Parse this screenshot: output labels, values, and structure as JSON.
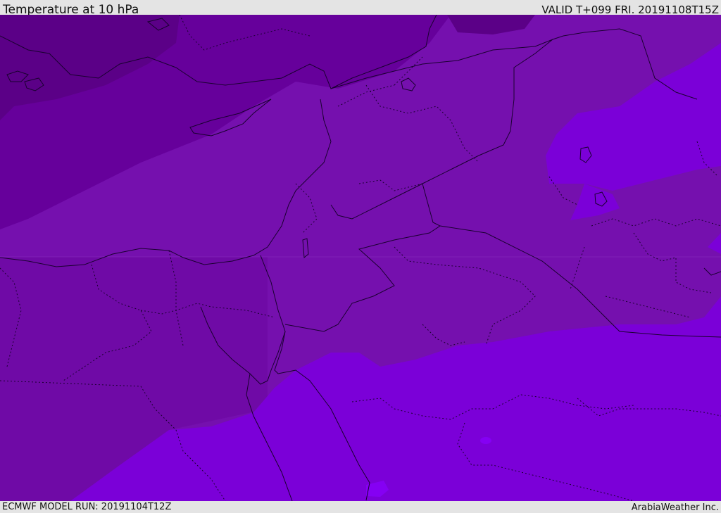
{
  "header": {
    "title": "Temperature at 10 hPa",
    "valid": "VALID T+099 FRI. 20191108T15Z"
  },
  "footer": {
    "model_run": "ECMWF MODEL RUN: 20191104T12Z",
    "credit": "ArabiaWeather Inc."
  },
  "colors": {
    "band_darkest": "#5b0087",
    "band_dark": "#66009b",
    "band_mid": "#7510ae",
    "band_light": "#7b00d8",
    "band_lightest": "#8500f3",
    "border_line": "#1a0030"
  }
}
